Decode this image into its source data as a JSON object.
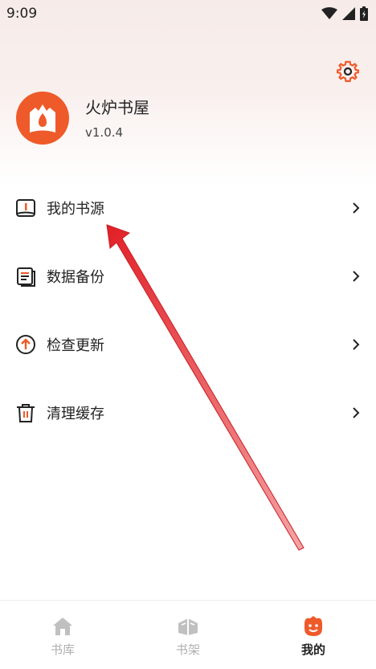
{
  "status_bar": {
    "time": "9:09"
  },
  "profile": {
    "app_name": "火炉书屋",
    "version": "v1.0.4"
  },
  "menu": {
    "items": [
      {
        "label": "我的书源",
        "icon": "book-source-icon"
      },
      {
        "label": "数据备份",
        "icon": "backup-icon"
      },
      {
        "label": "检查更新",
        "icon": "update-icon"
      },
      {
        "label": "清理缓存",
        "icon": "trash-icon"
      }
    ]
  },
  "bottom_nav": {
    "items": [
      {
        "label": "书库",
        "icon": "home-icon",
        "active": false
      },
      {
        "label": "书架",
        "icon": "bookshelf-icon",
        "active": false
      },
      {
        "label": "我的",
        "icon": "profile-face-icon",
        "active": true
      }
    ]
  },
  "colors": {
    "accent": "#ef5a2a",
    "arrow": "#e0151b",
    "inactive": "#b0b0b0"
  }
}
